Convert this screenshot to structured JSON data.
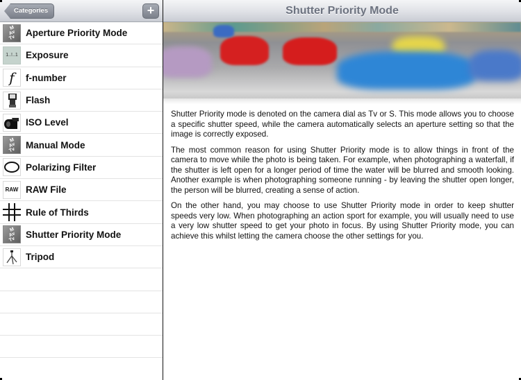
{
  "left_pane": {
    "back_button_label": "Categories",
    "add_button_label": "+",
    "items": [
      {
        "label": "Aperture Priority Mode",
        "icon": "mode-dial-icon"
      },
      {
        "label": "Exposure",
        "icon": "exposure-scale-icon",
        "icon_text": "1..!..1"
      },
      {
        "label": "f-number",
        "icon": "f-stop-icon",
        "icon_text": "f"
      },
      {
        "label": "Flash",
        "icon": "flash-icon"
      },
      {
        "label": "ISO Level",
        "icon": "film-roll-icon"
      },
      {
        "label": "Manual Mode",
        "icon": "mode-dial-icon"
      },
      {
        "label": "Polarizing Filter",
        "icon": "polarizing-filter-icon"
      },
      {
        "label": "RAW File",
        "icon": "raw-file-icon",
        "icon_text": "RAW"
      },
      {
        "label": "Rule of Thirds",
        "icon": "grid-icon"
      },
      {
        "label": "Shutter Priority Mode",
        "icon": "mode-dial-icon"
      },
      {
        "label": "Tripod",
        "icon": "tripod-icon"
      }
    ],
    "empty_rows": 5,
    "dial_icon_text": [
      "M",
      "Av",
      "Tv"
    ]
  },
  "right_pane": {
    "title": "Shutter Priority Mode",
    "hero_image": "bumper-cars-motion-blur-photo",
    "paragraphs": [
      "Shutter Priority mode is denoted on the camera dial as Tv or S. This mode allows you to choose a specific shutter speed, while the camera automatically selects an aperture setting so that the image is correctly exposed.",
      "The most common reason for using Shutter Priority mode is to allow things in front of the camera to move while the photo is being taken. For example, when photographing a waterfall, if the shutter is left open for a longer period of time the water will be blurred and smooth looking. Another example is when photographing someone running - by leaving the shutter open longer, the person will be blurred, creating a sense of action.",
      "On the other hand, you may choose to use Shutter Priority mode in order to keep shutter speeds very low. When photographing an action sport for example, you will usually need to use a very low shutter speed to get your photo in focus. By using Shutter Priority mode, you can achieve this whilst letting the camera choose the other settings for you."
    ]
  }
}
